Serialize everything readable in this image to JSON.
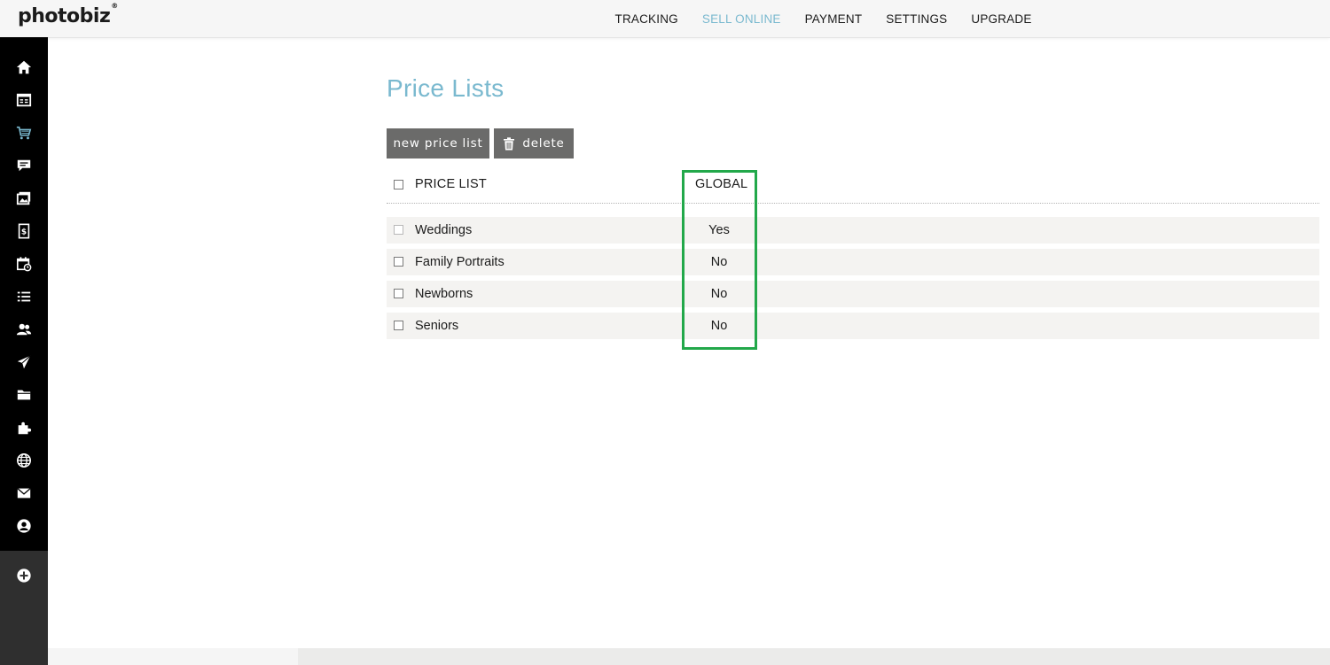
{
  "brand": {
    "logo_text": "photobiz",
    "logo_mark": "®"
  },
  "topnav": {
    "items": [
      {
        "label": "TRACKING",
        "active": false
      },
      {
        "label": "SELL ONLINE",
        "active": true
      },
      {
        "label": "PAYMENT",
        "active": false
      },
      {
        "label": "SETTINGS",
        "active": false
      },
      {
        "label": "UPGRADE",
        "active": false
      }
    ],
    "active_color": "#7ab9cf"
  },
  "sidebar": {
    "icons": [
      "home-icon",
      "website-pages-icon",
      "cart-icon",
      "comments-icon",
      "gallery-icon",
      "invoice-icon",
      "calendar-icon",
      "list-icon",
      "contacts-icon",
      "send-icon",
      "folder-icon",
      "plugin-icon",
      "globe-icon",
      "mail-icon",
      "account-icon"
    ],
    "add_icon": "plus-circle-icon"
  },
  "page": {
    "title": "Price Lists",
    "buttons": {
      "new_price_list": "new price list",
      "delete": "delete"
    },
    "table": {
      "headers": {
        "price_list": "PRICE LIST",
        "global": "GLOBAL"
      },
      "rows": [
        {
          "name": "Weddings",
          "global": "Yes"
        },
        {
          "name": "Family Portraits",
          "global": "No"
        },
        {
          "name": "Newborns",
          "global": "No"
        },
        {
          "name": "Seniors",
          "global": "No"
        }
      ]
    }
  },
  "colors": {
    "title": "#7ab9cf",
    "button_bg": "#6b6b6a",
    "highlight": "#22a84a",
    "row_bg": "#f4f3f1"
  }
}
